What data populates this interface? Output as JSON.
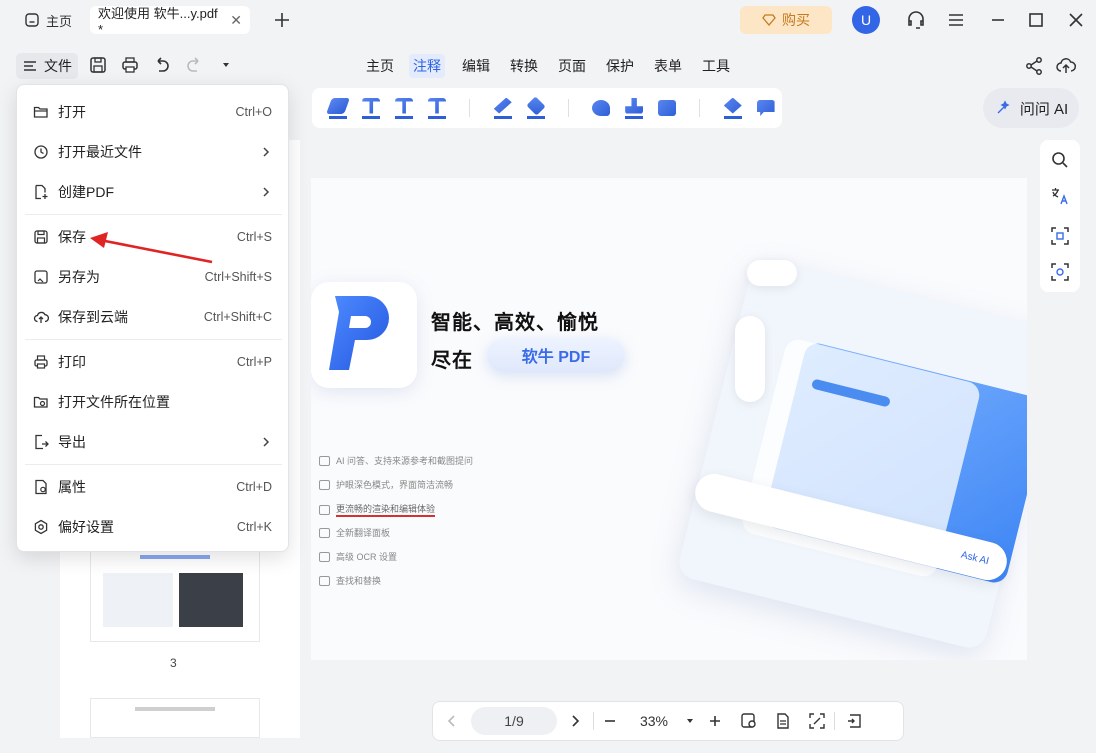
{
  "tabs": {
    "home_label": "主页",
    "doc_label": "欢迎使用 软牛...y.pdf *",
    "close_symbol": "✕"
  },
  "header": {
    "buy_label": "购买",
    "avatar_letter": "U"
  },
  "toolbar": {
    "file_label": "文件",
    "menus": [
      "主页",
      "注释",
      "编辑",
      "转换",
      "页面",
      "保护",
      "表单",
      "工具"
    ],
    "active_menu": "注释",
    "ask_ai_label": "问问 AI"
  },
  "file_menu": {
    "items": [
      {
        "label": "打开",
        "shortcut": "Ctrl+O",
        "icon": "folder-open-icon"
      },
      {
        "label": "打开最近文件",
        "shortcut": "",
        "icon": "clock-icon",
        "submenu": true
      },
      {
        "label": "创建PDF",
        "shortcut": "",
        "icon": "create-pdf-icon",
        "submenu": true
      },
      {
        "label": "保存",
        "shortcut": "Ctrl+S",
        "icon": "save-icon"
      },
      {
        "label": "另存为",
        "shortcut": "Ctrl+Shift+S",
        "icon": "save-as-icon"
      },
      {
        "label": "保存到云端",
        "shortcut": "Ctrl+Shift+C",
        "icon": "cloud-upload-icon"
      },
      {
        "label": "打印",
        "shortcut": "Ctrl+P",
        "icon": "printer-icon"
      },
      {
        "label": "打开文件所在位置",
        "shortcut": "",
        "icon": "folder-location-icon"
      },
      {
        "label": "导出",
        "shortcut": "",
        "icon": "export-icon",
        "submenu": true
      },
      {
        "label": "属性",
        "shortcut": "Ctrl+D",
        "icon": "properties-icon"
      },
      {
        "label": "偏好设置",
        "shortcut": "Ctrl+K",
        "icon": "settings-icon"
      }
    ]
  },
  "sidebar": {
    "thumb_page_number": "3"
  },
  "document": {
    "hero_line1": "智能、高效、愉悦",
    "hero_line2": "尽在",
    "hero_pill": "软牛 PDF",
    "features": [
      "AI 问答、支持来源参考和截图提问",
      "护眼深色模式，界面简洁流畅",
      "更流畅的渲染和编辑体验",
      "全新翻译面板",
      "高级 OCR 设置",
      "查找和替换"
    ],
    "mock_ask_ai": "Ask AI"
  },
  "bottom_bar": {
    "page_indicator": "1/9",
    "zoom": "33%"
  },
  "colors": {
    "accent": "#2e62e6",
    "buy_bg": "#fde6c6",
    "buy_text": "#c77a1c",
    "annotation_arrow": "#e02424"
  }
}
